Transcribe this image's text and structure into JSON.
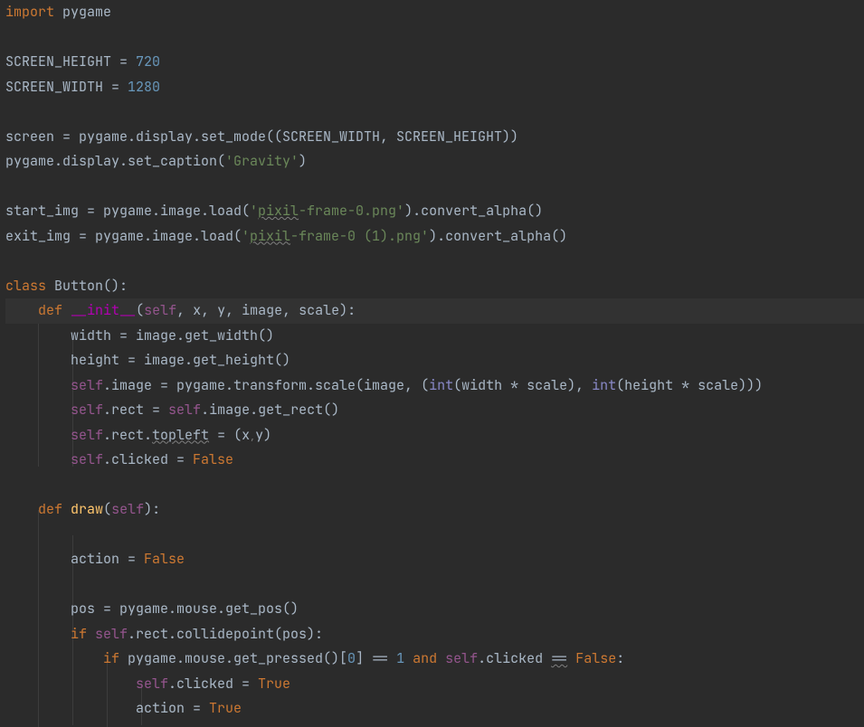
{
  "code": {
    "l1": {
      "kw_import": "import",
      "mod": " pygame"
    },
    "l3": {
      "lhs": "SCREEN_HEIGHT = ",
      "val": "720"
    },
    "l4": {
      "lhs": "SCREEN_WIDTH = ",
      "val": "1280"
    },
    "l6": {
      "text": "screen = pygame.display.set_mode((SCREEN_WIDTH, SCREEN_HEIGHT))"
    },
    "l7": {
      "pre": "pygame.display.set_caption(",
      "str": "'Gravity'",
      "post": ")"
    },
    "l9": {
      "pre": "start_img = pygame.image.load(",
      "q1": "'",
      "u": "pixil",
      "s_rest": "-frame-0.png'",
      "post": ").convert_alpha()"
    },
    "l10": {
      "pre": "exit_img = pygame.image.load(",
      "q1": "'",
      "u": "pixil",
      "s_rest": "-frame-0 (1).png'",
      "post": ").convert_alpha()"
    },
    "l12": {
      "kw_class": "class",
      "name": " Button",
      "par": "():"
    },
    "l13": {
      "kw_def": "def ",
      "magic": "__init__",
      "open": "(",
      "self": "self",
      "args_a": ", x",
      "args_b": ", y",
      "args_c": ", image",
      "args_d": ", scale):"
    },
    "l14": {
      "text": "width = image.get_width()"
    },
    "l15": {
      "text": "height = image.get_height()"
    },
    "l16": {
      "self": "self",
      "a": ".image = pygame.transform.scale(image",
      "comma": ", ",
      "p1": "(",
      "int1": "int",
      "b": "(width * scale)",
      "comma2": ", ",
      "int2": "int",
      "c": "(height * scale)))"
    },
    "l17": {
      "self1": "self",
      "a": ".rect = ",
      "self2": "self",
      "b": ".image.get_rect()"
    },
    "l18": {
      "self": "self",
      "a": ".rect.",
      "topleft": "topleft",
      "b": " = (x",
      "comma_small": ",",
      "c": "y)"
    },
    "l19": {
      "self": "self",
      "a": ".clicked = ",
      "false": "False"
    },
    "l21": {
      "kw_def": "def ",
      "name": "draw",
      "open": "(",
      "self": "self",
      "close": "):"
    },
    "l23": {
      "a": "action = ",
      "false": "False"
    },
    "l25": {
      "text": "pos = pygame.mouse.get_pos()"
    },
    "l26": {
      "kw_if": "if ",
      "self": "self",
      "a": ".rect.collidepoint(pos):"
    },
    "l27": {
      "kw_if": "if ",
      "a": "pygame.mouse.get_pressed()[",
      "zero": "0",
      "b": "] == ",
      "one": "1",
      "sp": " ",
      "and": "and",
      "sp2": " ",
      "self": "self",
      "c": ".clicked ",
      "eqeq": "==",
      "sp3": " ",
      "false": "False",
      "colon": ":"
    },
    "l28": {
      "self": "self",
      "a": ".clicked = ",
      "true": "True"
    },
    "l29": {
      "a": "action = ",
      "true": "True"
    }
  },
  "indent": {
    "i1": "    ",
    "i2": "        ",
    "i3": "            ",
    "i4": "                "
  }
}
